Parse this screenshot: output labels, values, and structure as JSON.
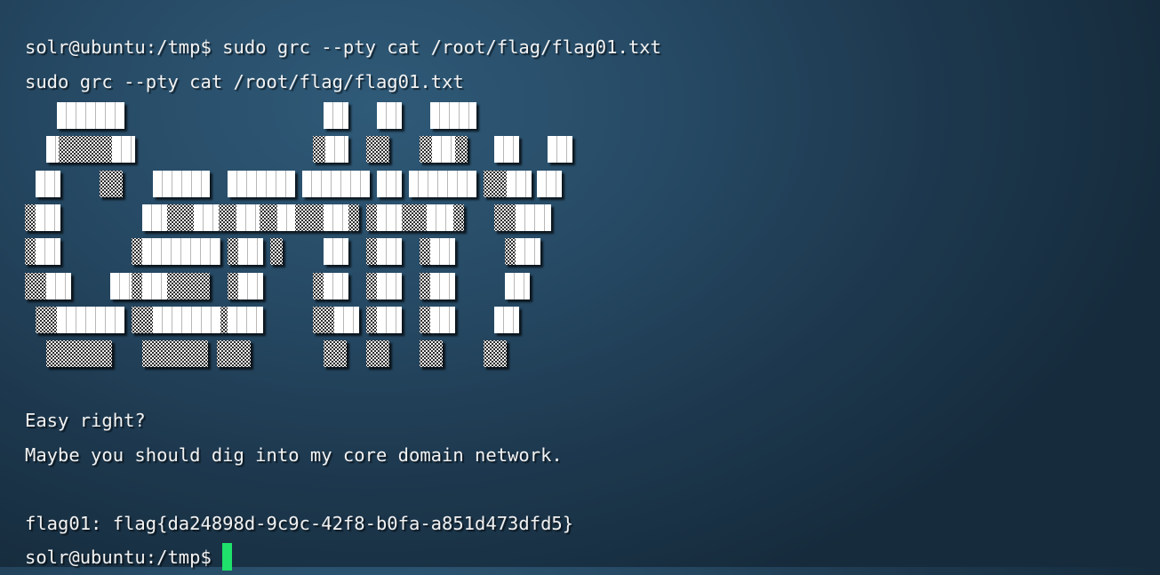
{
  "terminal": {
    "prompt": "solr@ubuntu:/tmp$",
    "command": " sudo grc --pty cat /root/flag/flag01.txt",
    "echo": "sudo grc --pty cat /root/flag/flag01.txt",
    "banner_art": "figlet-style block-character banner (decorative)",
    "message1": "Easy right?",
    "message2": "Maybe you should dig into my core domain network.",
    "flag_line": "flag01: flag{da24898d-9c9c-42f8-b0fa-a851d473dfd5}",
    "cursor_color": "#1ee06a"
  }
}
